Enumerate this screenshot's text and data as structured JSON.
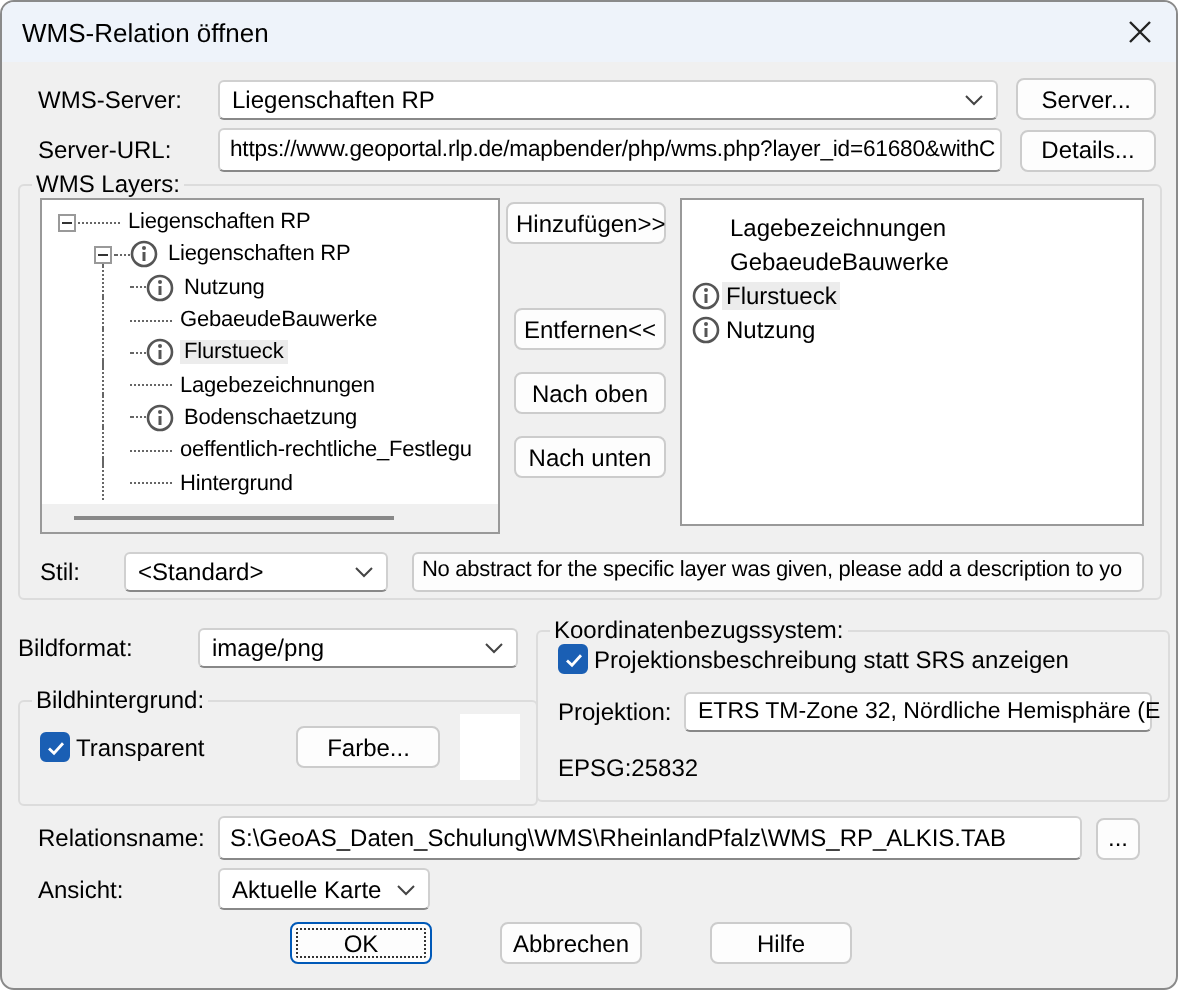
{
  "window": {
    "title": "WMS-Relation öffnen"
  },
  "server": {
    "label": "WMS-Server:",
    "value": "Liegenschaften RP",
    "button": "Server..."
  },
  "url": {
    "label": "Server-URL:",
    "value": "https://www.geoportal.rlp.de/mapbender/php/wms.php?layer_id=61680&withC",
    "button": "Details..."
  },
  "layers": {
    "title": "WMS Layers:",
    "tree": [
      {
        "label": "Liegenschaften RP",
        "info": false,
        "selected": false,
        "expanded": true,
        "children": [
          {
            "label": "Liegenschaften RP",
            "info": true,
            "selected": false,
            "expanded": true,
            "children": [
              {
                "label": "Nutzung",
                "info": true,
                "selected": false
              },
              {
                "label": "GebaeudeBauwerke",
                "info": false,
                "selected": false
              },
              {
                "label": "Flurstueck",
                "info": true,
                "selected": true
              },
              {
                "label": "Lagebezeichnungen",
                "info": false,
                "selected": false
              },
              {
                "label": "Bodenschaetzung",
                "info": true,
                "selected": false
              },
              {
                "label": "oeffentlich-rechtliche_Festlegu",
                "info": false,
                "selected": false
              },
              {
                "label": "Hintergrund",
                "info": false,
                "selected": false
              }
            ]
          }
        ]
      }
    ],
    "buttons": [
      "Hinzufügen>>",
      "Entfernen<<",
      "Nach oben",
      "Nach unten"
    ],
    "selected_layers": [
      {
        "label": "Lagebezeichnungen",
        "info": false,
        "selected": false
      },
      {
        "label": "GebaeudeBauwerke",
        "info": false,
        "selected": false
      },
      {
        "label": "Flurstueck",
        "info": true,
        "selected": true
      },
      {
        "label": "Nutzung",
        "info": true,
        "selected": false
      }
    ]
  },
  "style": {
    "label": "Stil:",
    "value": "<Standard>",
    "abstract": "No abstract for the specific layer was given, please add a description to yo"
  },
  "image_format": {
    "label": "Bildformat:",
    "value": "image/png"
  },
  "background": {
    "title": "Bildhintergrund:",
    "transparent": {
      "label": "Transparent",
      "checked": true
    },
    "color_button": "Farbe..."
  },
  "crs": {
    "title": "Koordinatenbezugssystem:",
    "show_description": {
      "label": "Projektionsbeschreibung statt SRS anzeigen",
      "checked": true
    },
    "projection_label": "Projektion:",
    "projection": "ETRS TM-Zone 32, Nördliche Hemisphäre (E",
    "code": "EPSG:25832"
  },
  "relation": {
    "label": "Relationsname:",
    "value": "S:\\GeoAS_Daten_Schulung\\WMS\\RheinlandPfalz\\WMS_RP_ALKIS.TAB",
    "browse": "..."
  },
  "view": {
    "label": "Ansicht:",
    "value": "Aktuelle Karte"
  },
  "buttons": [
    {
      "label": "OK",
      "default": true
    },
    {
      "label": "Abbrechen",
      "default": false
    },
    {
      "label": "Hilfe",
      "default": false
    }
  ]
}
